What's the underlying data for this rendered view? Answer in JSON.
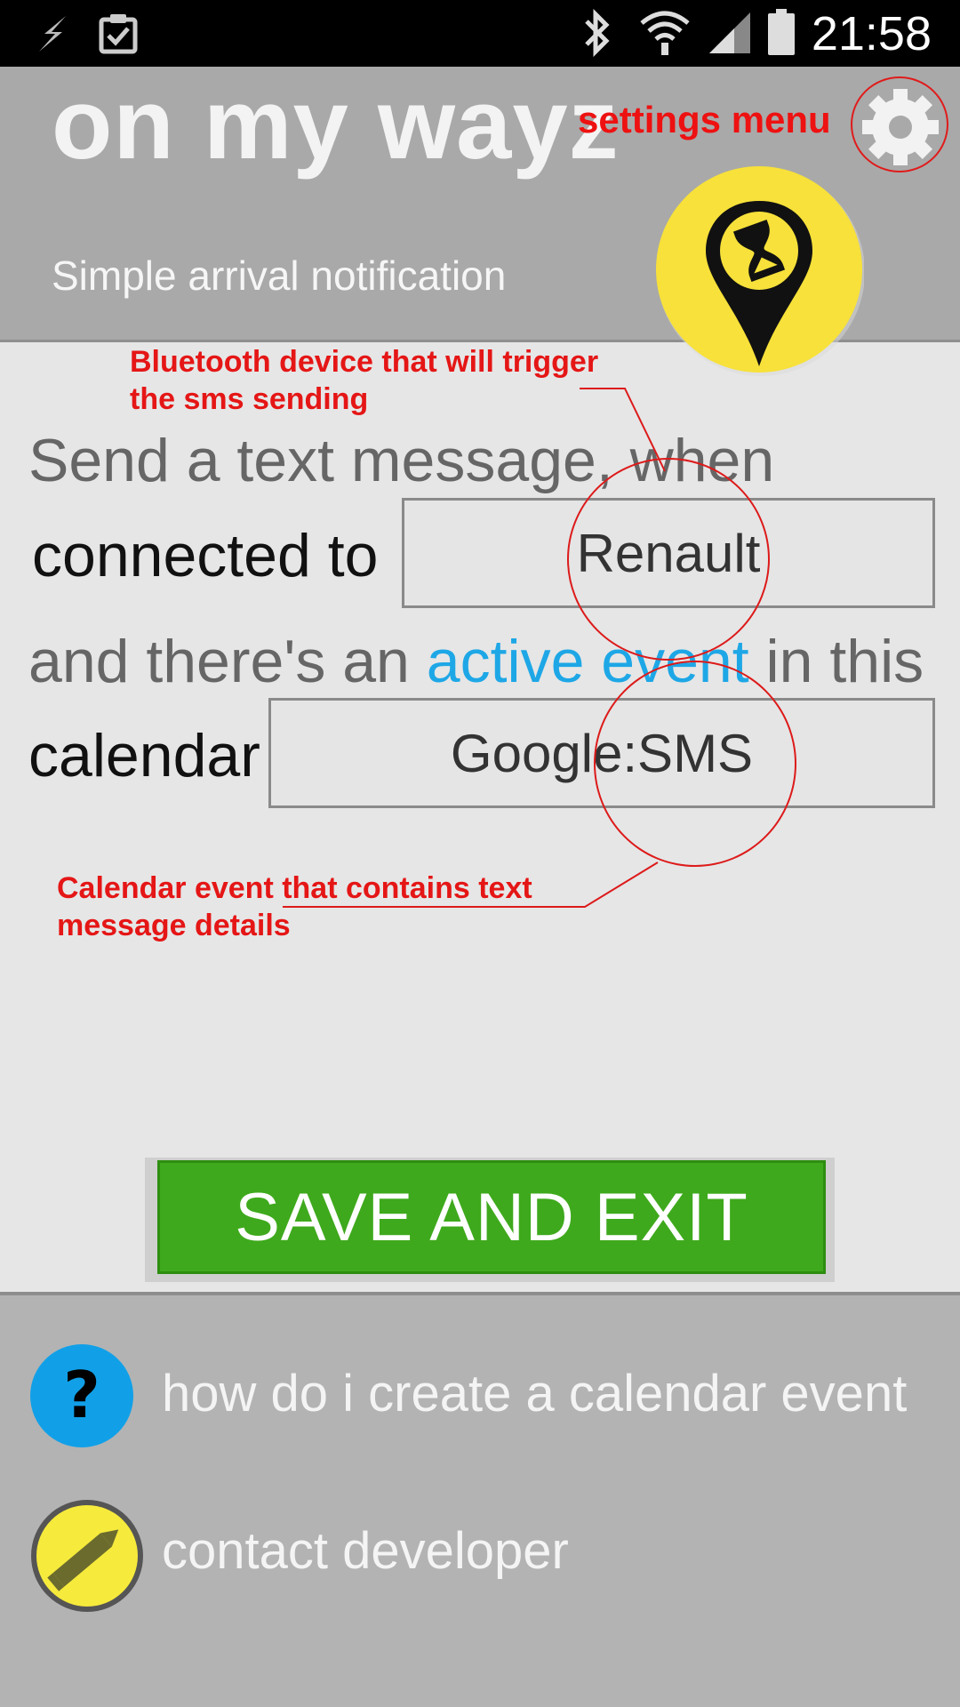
{
  "status_bar": {
    "time": "21:58",
    "icons": [
      "flash-icon",
      "clipboard-check-icon",
      "bluetooth-icon",
      "wifi-icon",
      "signal-icon",
      "battery-icon"
    ]
  },
  "header": {
    "title": "on my wayz",
    "subtitle": "Simple arrival notification"
  },
  "annotations": {
    "settings": "settings menu",
    "bluetooth_line1": "Bluetooth device that will trigger",
    "bluetooth_line2": "the sms sending",
    "calendar_line1": "Calendar event that contains text",
    "calendar_line2": "message details"
  },
  "form": {
    "line1": "Send a text message, when",
    "connected_label": "connected to",
    "bluetooth_device": "Renault",
    "line2_before": "and there's an ",
    "line2_link": "active event",
    "line2_after": " in this",
    "calendar_label": "calendar",
    "calendar_value": "Google:SMS"
  },
  "save_button": "SAVE AND EXIT",
  "bottom": {
    "help_label": "how do i create a calendar event",
    "contact_label": "contact developer"
  },
  "colors": {
    "accent_link": "#1ea7e6",
    "save_green": "#3ea91c",
    "annotation_red": "#e51616",
    "logo_yellow": "#f7e13a"
  }
}
